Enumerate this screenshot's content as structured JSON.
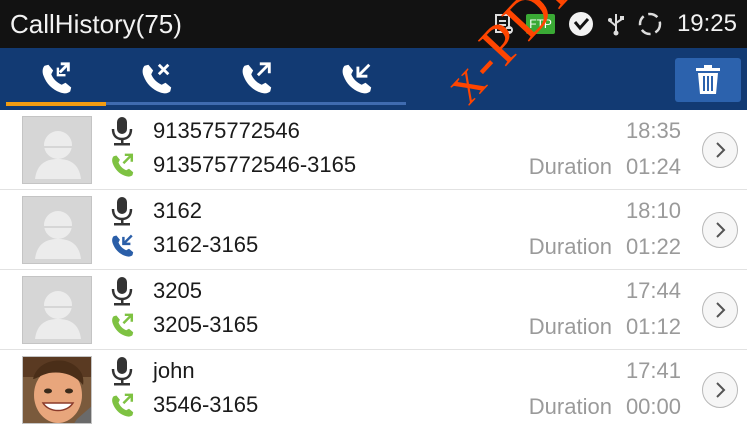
{
  "status_bar": {
    "title": "CallHistory(75)",
    "ftp_badge": "FTP",
    "time": "19:25"
  },
  "toolbar": {
    "tabs": [
      {
        "icon": "all-calls-icon",
        "active": true
      },
      {
        "icon": "missed-call-icon",
        "active": false
      },
      {
        "icon": "outgoing-call-icon",
        "active": false
      },
      {
        "icon": "incoming-call-icon",
        "active": false
      }
    ],
    "delete_icon": "trash-icon"
  },
  "calls": [
    {
      "name": "913575772546",
      "number": "913575772546-3165",
      "time": "18:35",
      "duration_label": "Duration",
      "duration": "01:24",
      "direction": "outgoing",
      "avatar": "default"
    },
    {
      "name": "3162",
      "number": "3162-3165",
      "time": "18:10",
      "duration_label": "Duration",
      "duration": "01:22",
      "direction": "incoming",
      "avatar": "default"
    },
    {
      "name": "3205",
      "number": "3205-3165",
      "time": "17:44",
      "duration_label": "Duration",
      "duration": "01:12",
      "direction": "outgoing",
      "avatar": "default"
    },
    {
      "name": "john",
      "number": "3546-3165",
      "time": "17:41",
      "duration_label": "Duration",
      "duration": "00:00",
      "direction": "outgoing",
      "avatar": "photo"
    }
  ],
  "watermark": "x-PDFD",
  "colors": {
    "status_bar": "#121212",
    "toolbar": "#123a73",
    "active_tab_underline": "#f39c12",
    "trash_button": "#2c62ad",
    "outgoing": "#7ec242",
    "incoming": "#2a5ea8",
    "watermark": "#ff4500"
  }
}
